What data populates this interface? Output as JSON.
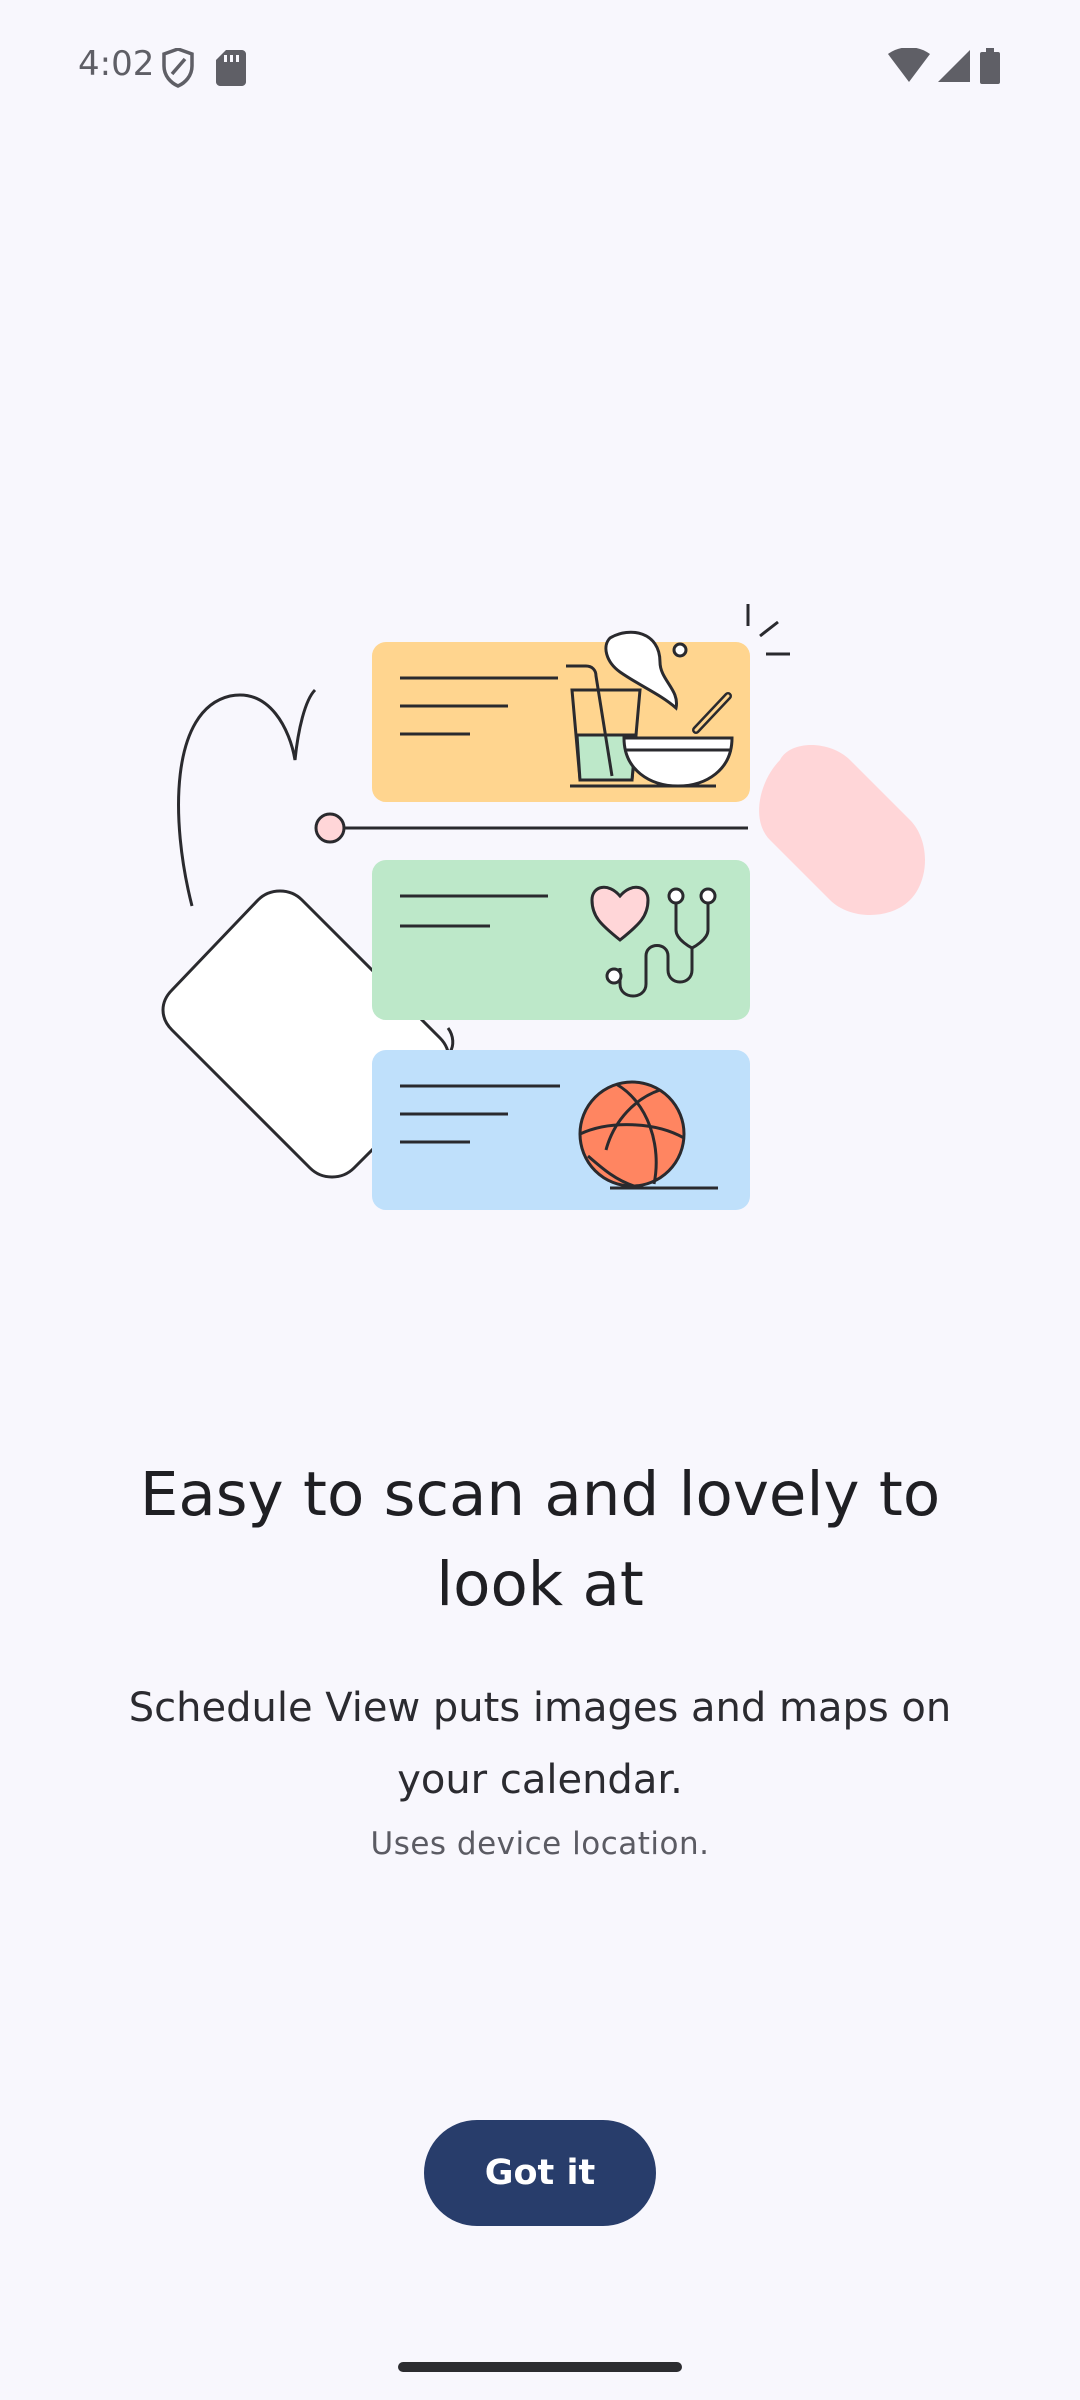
{
  "status_bar": {
    "time": "4:02",
    "left_icons": [
      "shield-icon",
      "sd-card-icon"
    ],
    "right_icons": [
      "wifi-icon",
      "cellular-signal-icon",
      "battery-icon"
    ]
  },
  "illustration": {
    "description_icons": [
      "food-bowl-icon",
      "stethoscope-heart-icon",
      "basketball-icon"
    ],
    "card_colors": [
      "#ffd58f",
      "#bde8c9",
      "#bfe0fb"
    ],
    "accent_color": "#ffd6d8"
  },
  "onboarding": {
    "headline": "Easy to scan and lovely to look at",
    "subtitle": "Schedule View puts images and maps on your calendar.",
    "caption": "Uses device location."
  },
  "actions": {
    "got_it_label": "Got it",
    "button_color": "#283d6b"
  }
}
